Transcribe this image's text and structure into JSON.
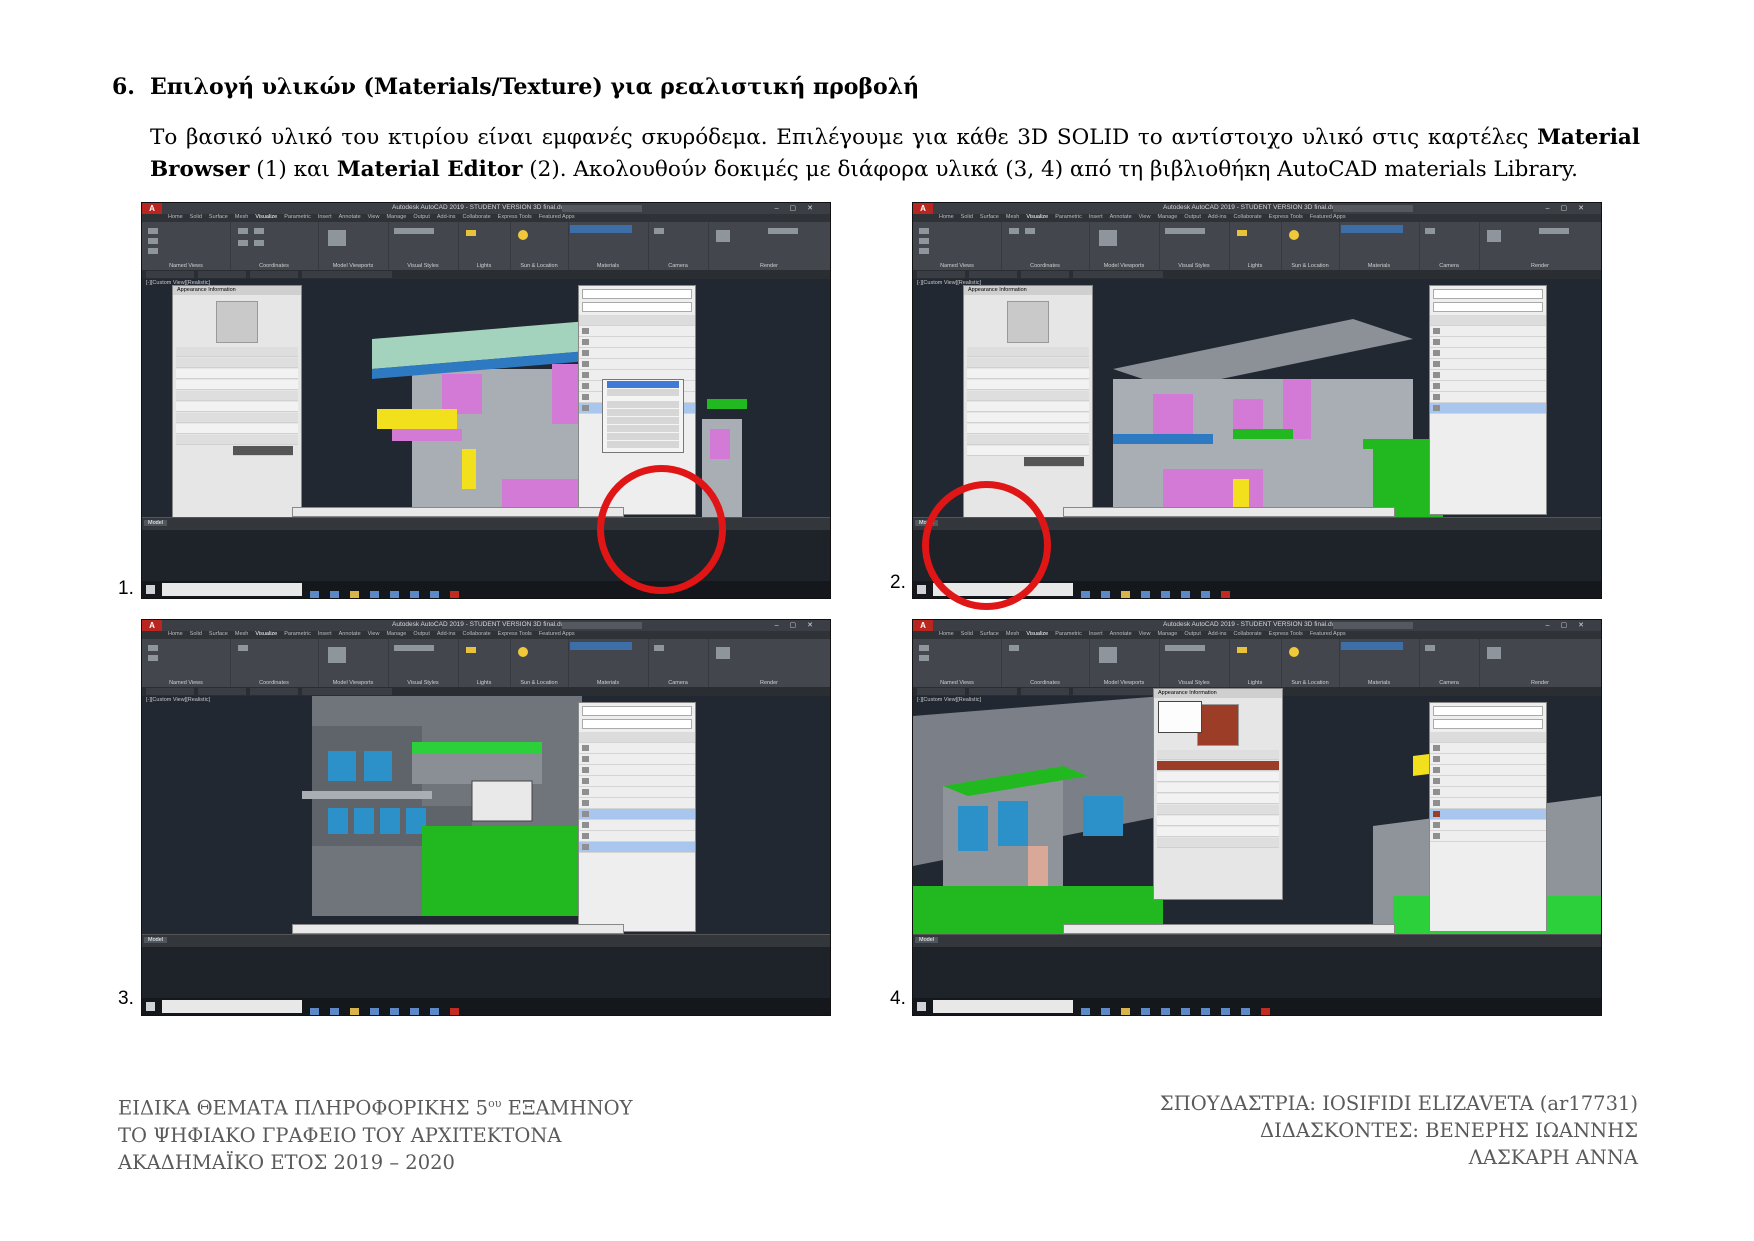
{
  "section": {
    "number": "6.",
    "title": "Επιλογή υλικών (Materials/Texture) για ρεαλιστική προβολή"
  },
  "paragraph": {
    "part1": "Το βασικό υλικό του κτιρίου είναι εμφανές σκυρόδεμα. Επιλέγουμε για κάθε 3D SOLID το αντίστοιχο υλικό στις καρτέλες ",
    "bold1": "Material Browser",
    "part2": " (1) και ",
    "bold2": "Material Editor",
    "part3": " (2). Ακολουθούν δοκιμές με διάφορα υλικά (3, 4) από τη βιβλιοθήκη AutoCAD materials Library."
  },
  "screenshots": [
    {
      "label": "1.",
      "window_title": "Autodesk AutoCAD 2019 - STUDENT VERSION   3D final.dwg",
      "viewport_label": "[-][Custom View][Realistic]",
      "tab": "Model"
    },
    {
      "label": "2.",
      "window_title": "Autodesk AutoCAD 2019 - STUDENT VERSION   3D final.dwg",
      "viewport_label": "[-][Custom View][Realistic]",
      "tab": "Model"
    },
    {
      "label": "3.",
      "window_title": "Autodesk AutoCAD 2019 - STUDENT VERSION   3D final.dwg",
      "viewport_label": "[-][Custom View][Realistic]",
      "tab": "Model"
    },
    {
      "label": "4.",
      "window_title": "Autodesk AutoCAD 2019 - STUDENT VERSION   3D final.dwg",
      "viewport_label": "[-][Custom View][Realistic]",
      "tab": "Model"
    }
  ],
  "menu_tabs": [
    "Home",
    "Solid",
    "Surface",
    "Mesh",
    "Visualize",
    "Parametric",
    "Insert",
    "Annotate",
    "View",
    "Manage",
    "Output",
    "Add-ins",
    "Collaborate",
    "Express Tools",
    "Featured Apps"
  ],
  "active_menu_tab": "Visualize",
  "ribbon_groups": [
    "Named Views",
    "Coordinates",
    "Model Viewports",
    "Visual Styles",
    "Lights",
    "Sun & Location",
    "Materials",
    "Camera",
    "Render"
  ],
  "colors": {
    "concrete": "#a9aeb4",
    "magenta_walls": "#d27ad6",
    "yellow": "#f2e01c",
    "green": "#22b81f",
    "glass_blue": "#2b91c8",
    "highlight_circle": "#e01616",
    "autocad_red": "#b8261f"
  },
  "footer": {
    "left_line1_pre": "ΕΙΔΙΚΑ ΘΕΜΑΤΑ ΠΛΗΡΟΦΟΡΙΚΗΣ 5",
    "left_line1_sup": "ου",
    "left_line1_post": " ΕΞΑΜΗΝΟΥ",
    "left_line2": "ΤΟ ΨΗΦΙΑΚΟ ΓΡΑΦΕΙΟ ΤΟΥ ΑΡΧΙΤΕΚΤΟΝΑ",
    "left_line3": "ΑΚΑΔΗΜΑΪΚΟ ΕΤΟΣ 2019 – 2020",
    "right_line1": "ΣΠΟΥΔΑΣΤΡΙΑ: IOSIFIDI ELIZAVETA (ar17731)",
    "right_line2": "ΔΙΔΑΣΚΟΝΤΕΣ: ΒΕΝΕΡΗΣ ΙΩΑΝΝΗΣ",
    "right_line3": "ΛΑΣΚΑΡΗ ΑΝΝΑ"
  }
}
